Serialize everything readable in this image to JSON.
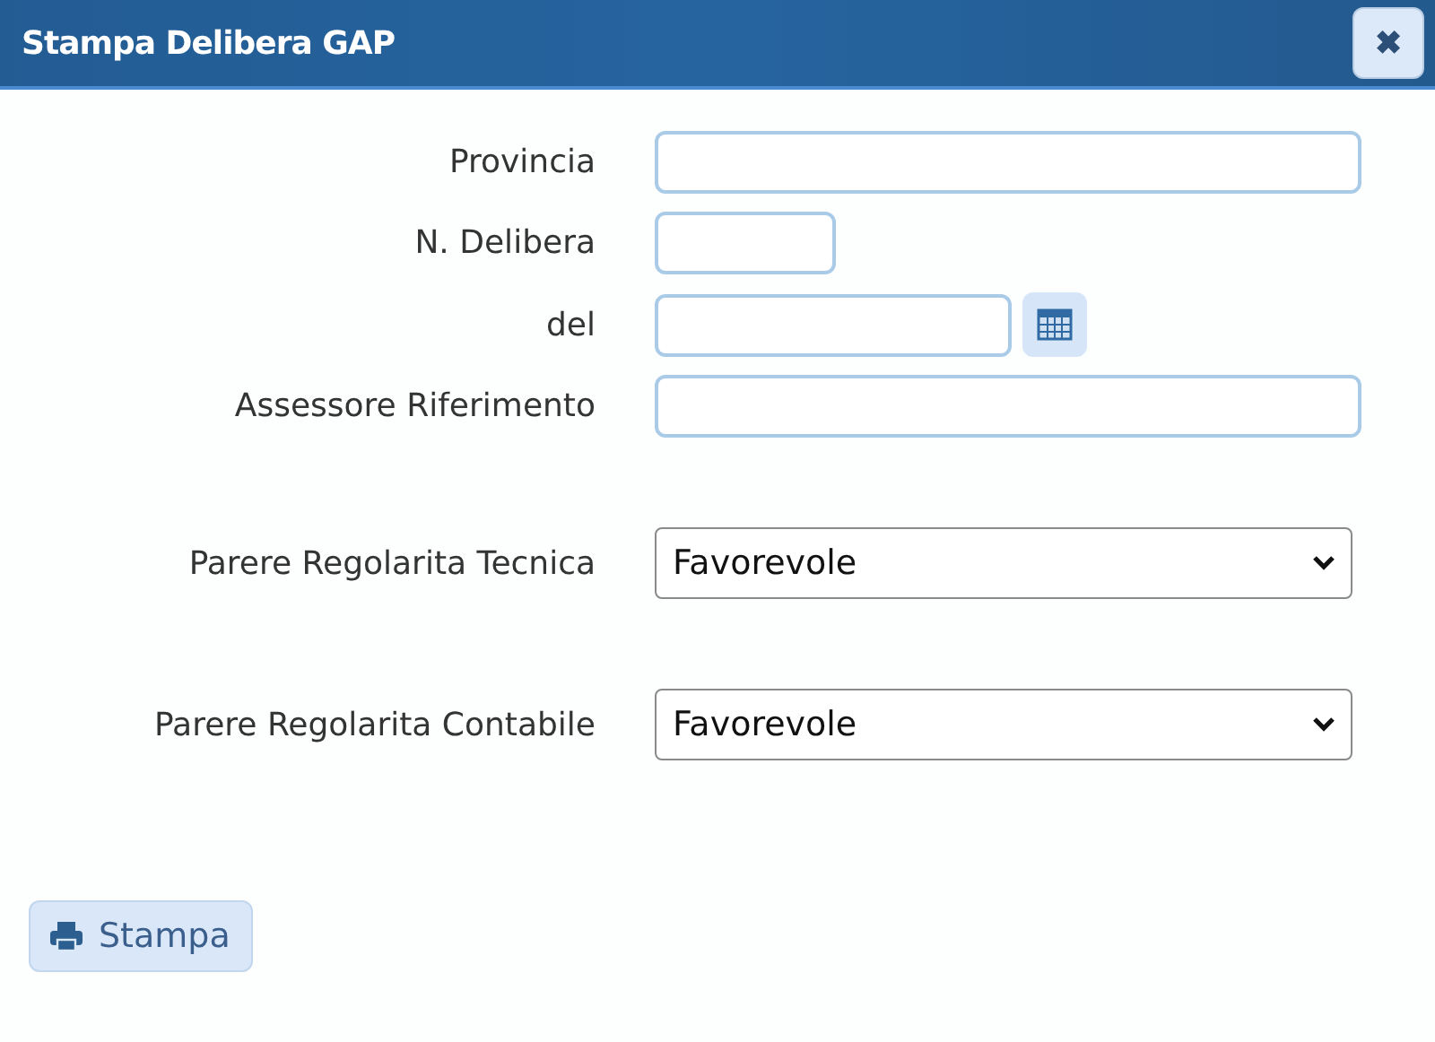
{
  "window": {
    "title": "Stampa Delibera GAP",
    "close_icon": "✖"
  },
  "fields": [
    {
      "label": "Provincia",
      "kind": "text"
    },
    {
      "label": "N. Delibera",
      "kind": "number"
    },
    {
      "label": "del",
      "kind": "date"
    },
    {
      "label": "Assessore Riferimento",
      "kind": "text"
    },
    {
      "label": "Parere Regolarita Tecnica",
      "kind": "select",
      "value": "Favorevole"
    },
    {
      "label": "Parere Regolarita Contabile",
      "kind": "select",
      "value": "Favorevole"
    }
  ],
  "buttons": [
    {
      "label": "Stampa",
      "kind": "print"
    }
  ]
}
